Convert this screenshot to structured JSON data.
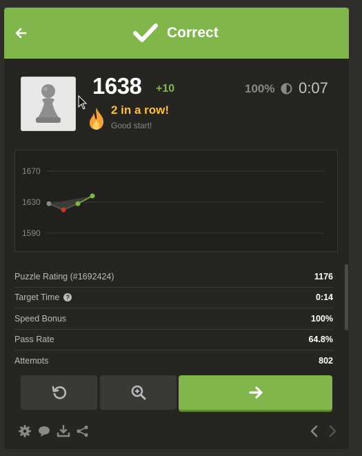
{
  "header": {
    "title": "Correct",
    "back_icon": "arrow-left-icon",
    "check_icon": "checkmark-icon",
    "bg_color": "#81b64c"
  },
  "player": {
    "avatar_icon": "pawn-icon",
    "rating": "1638",
    "rating_delta": "+10",
    "accuracy": "100%",
    "timer_icon": "half-circle-clock-icon",
    "time": "0:07"
  },
  "streak": {
    "icon": "fire-icon",
    "title": "2 in a row!",
    "subtitle": "Good start!",
    "color": "#f7c045"
  },
  "chart_data": {
    "type": "line",
    "x": [
      1,
      2,
      3,
      4
    ],
    "series": [
      {
        "values": [
          1628,
          1620,
          1628,
          1638
        ],
        "point_colors": [
          "#8b8987",
          "#ca3431",
          "#81b64c",
          "#81b64c"
        ]
      }
    ],
    "yticks": [
      "1670",
      "1630",
      "1590"
    ],
    "ylim": [
      1590,
      1670
    ],
    "grid": true,
    "legend": "none"
  },
  "stats": [
    {
      "label": "Puzzle Rating (#1692424)",
      "value": "1176",
      "help": false
    },
    {
      "label": "Target Time",
      "value": "0:14",
      "help": true
    },
    {
      "label": "Speed Bonus",
      "value": "100%",
      "help": false
    },
    {
      "label": "Pass Rate",
      "value": "64.8%",
      "help": false
    },
    {
      "label": "Attempts",
      "value": "802",
      "help": false
    }
  ],
  "actions": {
    "retry_icon": "retry-icon",
    "analyze_icon": "magnifier-icon",
    "next_icon": "arrow-right-icon"
  },
  "footer": {
    "icons": [
      "gear-icon",
      "chat-icon",
      "download-icon",
      "share-icon",
      "chevron-left-icon",
      "chevron-right-icon"
    ]
  }
}
